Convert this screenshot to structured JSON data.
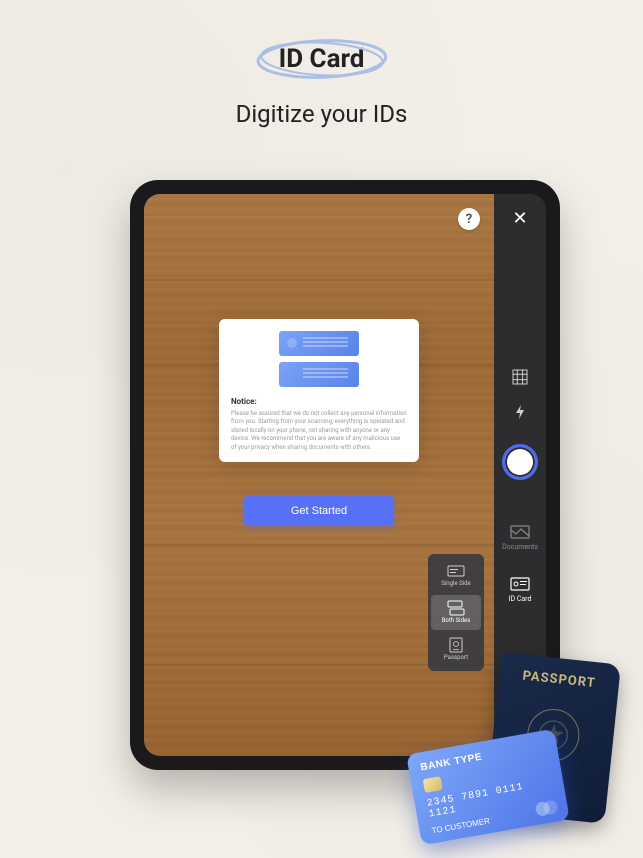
{
  "hero": {
    "badge": "ID Card",
    "subtitle": "Digitize your IDs"
  },
  "viewport": {
    "help_label": "?"
  },
  "modal": {
    "notice_title": "Notice:",
    "notice_body": "Please be assured that we do not collect any personal information from you. Starting from your scanning, everything is operated and stored locally on your phone, not sharing with anyone or any device. We recommend that you are aware of any malicious use of your privacy when sharing documents with others.",
    "cta_label": "Get Started"
  },
  "scan_types": {
    "items": [
      {
        "label": "Single Side"
      },
      {
        "label": "Both Sides"
      },
      {
        "label": "Passport"
      }
    ]
  },
  "sidebar": {
    "close_label": "✕",
    "modes": {
      "documents": "Documents",
      "id_card": "ID Card"
    }
  },
  "overlay": {
    "passport_title": "PASSPORT",
    "card_title": "BANK TYPE",
    "card_number": "2345 7891 0111 1121",
    "card_holder": "TO CUSTOMER"
  }
}
